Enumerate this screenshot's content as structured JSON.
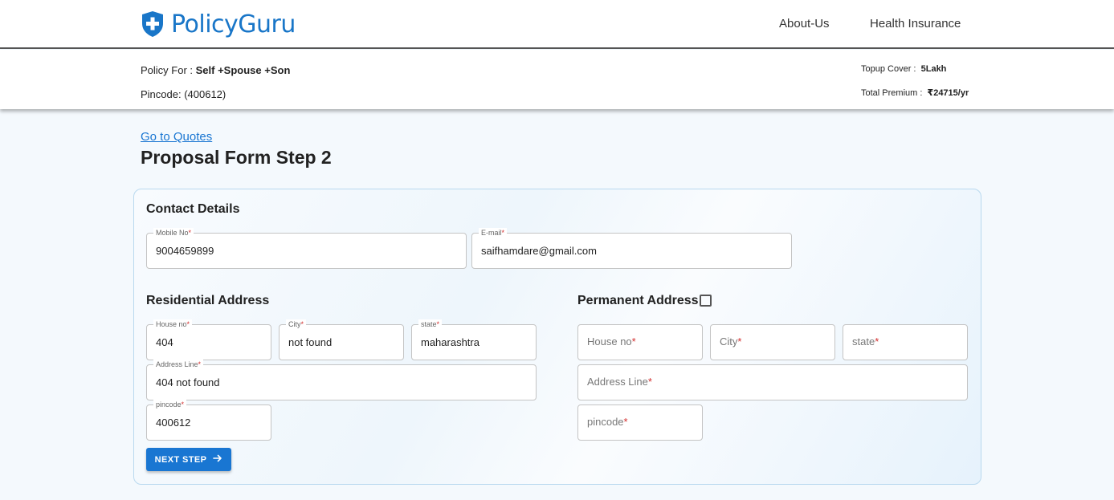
{
  "header": {
    "brand": "PolicyGuru",
    "nav": [
      "About-Us",
      "Health Insurance"
    ]
  },
  "summary": {
    "policy_for_label": "Policy For :",
    "policy_for_value": "Self +Spouse +Son",
    "pincode_text": "Pincode: (400612)",
    "topup_label": "Topup Cover :",
    "topup_value": "5Lakh",
    "premium_label": "Total Premium :",
    "premium_value": "₹24715/yr"
  },
  "page": {
    "goto_link": "Go to Quotes",
    "title": "Proposal Form Step 2"
  },
  "contact": {
    "title": "Contact Details",
    "mobile_label": "Mobile No",
    "mobile_value": "9004659899",
    "email_label": "E-mail",
    "email_value": "saifhamdare@gmail.com"
  },
  "residential": {
    "title": "Residential Address",
    "house_label": "House no",
    "house_value": "404",
    "city_label": "City",
    "city_value": "not found",
    "state_label": "state",
    "state_value": "maharashtra",
    "address_label": "Address Line",
    "address_value": "404 not found",
    "pincode_label": "pincode",
    "pincode_value": "400612"
  },
  "permanent": {
    "title": "Permanent Address",
    "checked": false,
    "house_placeholder": "House no",
    "city_placeholder": "City",
    "state_placeholder": "state",
    "address_placeholder": "Address Line",
    "pincode_placeholder": "pincode"
  },
  "actions": {
    "next_label": "NEXT STEP"
  },
  "colors": {
    "brand_blue": "#1976c8",
    "button_blue": "#1976d2",
    "required_red": "#d32f2f"
  },
  "icons": [
    "shield-plus-icon",
    "arrow-right-icon",
    "checkbox-icon"
  ]
}
